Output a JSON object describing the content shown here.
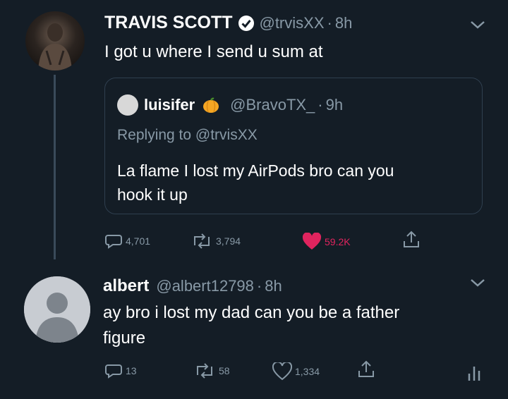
{
  "tweet1": {
    "display_name": "TRAVIS SCOTT",
    "handle": "@trvisXX",
    "separator": "·",
    "time": "8h",
    "text": "I got u where I send u sum at",
    "stats": {
      "replies": "4,701",
      "retweets": "3,794",
      "likes": "59.2K"
    }
  },
  "quote": {
    "display_name": "luisifer",
    "handle": "@BravoTX_",
    "separator": "·",
    "time": "9h",
    "replying_prefix": "Replying to",
    "replying_handle": "@trvisXX",
    "text_line1": "La flame I lost my AirPods bro can you",
    "text_line2": "hook it up"
  },
  "tweet2": {
    "display_name": "albert",
    "handle": "@albert12798",
    "separator": "·",
    "time": "8h",
    "text_line1": "ay bro i lost my dad can you be a father",
    "text_line2": "figure",
    "stats": {
      "replies": "13",
      "retweets": "58",
      "likes": "1,334"
    }
  },
  "colors": {
    "background": "#141d26",
    "secondary_text": "#8899a6",
    "like_active": "#e0245e",
    "verified_badge": "#ffffff"
  },
  "icons": {
    "reply": "reply-icon",
    "retweet": "retweet-icon",
    "like": "heart-icon",
    "share": "share-icon",
    "analytics": "analytics-icon",
    "verified": "verified-badge-icon",
    "emoji": "pumpkin-emoji-icon",
    "chevron": "chevron-down-icon"
  }
}
